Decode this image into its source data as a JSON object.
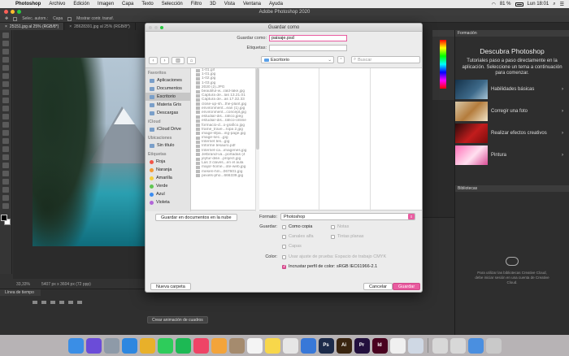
{
  "menubar": {
    "app": "Photoshop",
    "items": [
      "Archivo",
      "Edición",
      "Imagen",
      "Capa",
      "Texto",
      "Selección",
      "Filtro",
      "3D",
      "Vista",
      "Ventana",
      "Ayuda"
    ],
    "battery": "81 %",
    "clock": "Lun 18:01"
  },
  "window": {
    "title": "Adobe Photoshop 2020"
  },
  "options_bar": {
    "items": [
      "Selec. autom.:",
      "Capa",
      "Mostrar contr. transf."
    ]
  },
  "doc_tabs": [
    "25151.jpg al 25% (RGB/8*)",
    "28628391.jpg al 25% (RGB/8*)"
  ],
  "status": {
    "zoom": "33,33%",
    "doc": "5407 px x 3604 px (72 ppp)"
  },
  "timeline": {
    "title": "Línea de tiempo",
    "button": "Crear animación de cuadros"
  },
  "learn": {
    "tab": "Formación",
    "heading": "Descubra Photoshop",
    "desc": "Tutoriales paso a paso directamente en la aplicación. Seleccione un tema a continuación para comenzar.",
    "cards": [
      "Habilidades básicas",
      "Corregir una foto",
      "Realizar efectos creativos",
      "Pintura"
    ]
  },
  "libraries": {
    "tab": "Bibliotecas",
    "msg": "Para utilizar las bibliotecas Creative Cloud, debe iniciar sesión en una cuenta de Creative Cloud."
  },
  "dialog": {
    "title": "Guardar como",
    "save_as_label": "Guardar como:",
    "save_as_value": "paisaje.psd",
    "tags_label": "Etiquetas:",
    "location": "Escritorio",
    "search_placeholder": "Buscar",
    "sidebar": {
      "favorites_label": "Favoritos",
      "favorites": [
        "Aplicaciones",
        "Documentos",
        "Escritorio",
        "Materia Gris",
        "Descargas"
      ],
      "icloud_label": "iCloud",
      "icloud": [
        "iCloud Drive"
      ],
      "locations_label": "Ubicaciones",
      "locations": [
        "Sin título"
      ],
      "tags_label": "Etiquetas",
      "tags": [
        {
          "name": "Roja",
          "color": "#f25548"
        },
        {
          "name": "Naranja",
          "color": "#f59a33"
        },
        {
          "name": "Amarilla",
          "color": "#f4cf3d"
        },
        {
          "name": "Verde",
          "color": "#5fc552"
        },
        {
          "name": "Azul",
          "color": "#3b8cf0"
        },
        {
          "name": "Violeta",
          "color": "#b266d8"
        }
      ]
    },
    "files": [
      "1-01.gif",
      "1-01.jpg",
      "1-02.jpg",
      "1-03.jpg",
      "2020 (2).JPG",
      "beautiful-w...rald-lake.jpg",
      "Captura de...las 13.21.01",
      "Captura de...as 17.32.33",
      "close-up-sh...the-plant.jpg",
      "environment...ean (1).jpg",
      "environment...concept.jpg",
      "estudiar-dis...ráfico.jpeg",
      "estudiar-dis...ráfico-online",
      "formacio-d...o-grafico.jpg",
      "frame_trave...ropa 2.jpg",
      "image-sfpa...ing-page.jpg",
      "image-sec...jpg",
      "Internet tes...jpg",
      "Informe tesauro.pdf",
      "Internet-ca...imagenes.jpg",
      "Jetbrand-va...portadas (4",
      "jeytur-dise...project.jpg",
      "Las 3 claves...en el aula",
      "major-home...ote-web.jpg",
      "meseri-hm...067601.jpg",
      "pexels-pho...666339.jpg"
    ],
    "new_doc_button": "Guardar en documentos en la nube",
    "format_label": "Formato:",
    "format_value": "Photoshop",
    "save_label": "Guardar:",
    "options": [
      {
        "label": "Como copia",
        "checked": false,
        "disabled": false
      },
      {
        "label": "Notas",
        "checked": false,
        "disabled": true
      },
      {
        "label": "Canales alfa",
        "checked": false,
        "disabled": true
      },
      {
        "label": "Tintas planas",
        "checked": false,
        "disabled": true
      },
      {
        "label": "Capas",
        "checked": false,
        "disabled": true
      }
    ],
    "color_label": "Color:",
    "proof_label": "Usar ajuste de prueba: Espacio de trabajo CMYK",
    "profile_label": "Incrustar perfil de color: sRGB IEC61966-2.1",
    "new_folder": "Nueva carpeta",
    "cancel": "Cancelar",
    "save": "Guardar"
  },
  "dock_apps": [
    {
      "name": "finder",
      "color": "#3a8ee6",
      "label": ""
    },
    {
      "name": "siri",
      "color": "#6b4cd8",
      "label": ""
    },
    {
      "name": "launchpad",
      "color": "#8e9aa8",
      "label": ""
    },
    {
      "name": "safari",
      "color": "#2d87e0",
      "label": ""
    },
    {
      "name": "chrome",
      "color": "#e8b02a",
      "label": ""
    },
    {
      "name": "whatsapp",
      "color": "#2ecc5b",
      "label": ""
    },
    {
      "name": "spotify",
      "color": "#1db954",
      "label": ""
    },
    {
      "name": "music",
      "color": "#ef4466",
      "label": ""
    },
    {
      "name": "photos",
      "color": "#f3a43b",
      "label": ""
    },
    {
      "name": "contacts",
      "color": "#a58b6e",
      "label": ""
    },
    {
      "name": "calendar",
      "color": "#f4f4f4",
      "label": ""
    },
    {
      "name": "notes",
      "color": "#f8d74a",
      "label": ""
    },
    {
      "name": "reminders",
      "color": "#e6e6e6",
      "label": ""
    },
    {
      "name": "keynote",
      "color": "#3878d8",
      "label": ""
    },
    {
      "name": "photoshop",
      "color": "#1c2b4a",
      "label": "Ps"
    },
    {
      "name": "illustrator",
      "color": "#3a2510",
      "label": "Ai"
    },
    {
      "name": "premiere",
      "color": "#23103e",
      "label": "Pr"
    },
    {
      "name": "indesign",
      "color": "#49021f",
      "label": "Id"
    },
    {
      "name": "textedit",
      "color": "#f0f0f0",
      "label": ""
    },
    {
      "name": "preview",
      "color": "#cfd8e4",
      "label": ""
    },
    {
      "name": "finder-doc-1",
      "color": "#d8d8d8",
      "label": ""
    },
    {
      "name": "finder-doc-2",
      "color": "#d8d8d8",
      "label": ""
    },
    {
      "name": "downloads",
      "color": "#4a8fe0",
      "label": ""
    },
    {
      "name": "trash",
      "color": "#c9c9c9",
      "label": ""
    }
  ]
}
